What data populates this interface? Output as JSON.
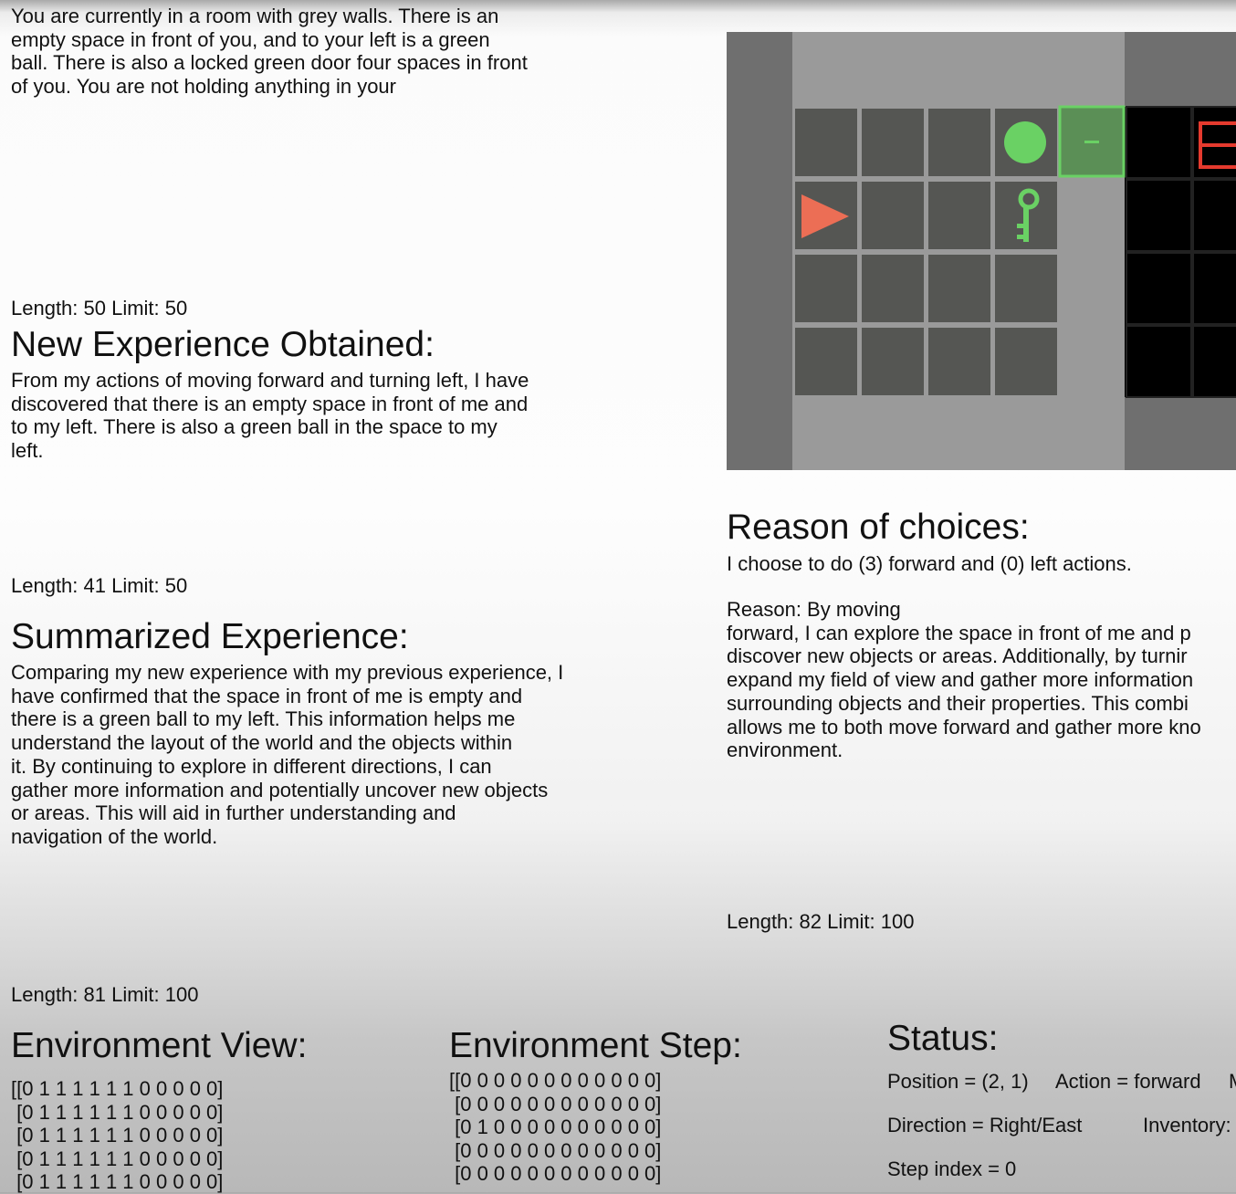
{
  "observation": {
    "text": " You are currently in a room with grey walls. There is an\nempty space in front of you, and to your left is a green\nball. There is also a locked green door four spaces in front\nof you. You are not holding anything in your",
    "meta": "Length: 50 Limit: 50"
  },
  "new_experience": {
    "title": "New Experience Obtained:",
    "text": " From my actions of moving forward and turning left, I have\ndiscovered that there is an empty space in front of me and\nto my left. There is also a green ball in the space to my\nleft.",
    "meta": "Length: 41 Limit: 50"
  },
  "summarized_experience": {
    "title": "Summarized Experience:",
    "text": " Comparing my new experience with my previous experience, I\nhave confirmed that the space in front of me is empty and\nthere is a green ball to my left. This information helps me\nunderstand the layout of the world and the objects within\nit. By continuing to explore in different directions, I can\ngather more information and potentially uncover new objects\nor areas. This will aid in further understanding and\nnavigation of the world.",
    "meta": "Length: 81 Limit: 100"
  },
  "reason": {
    "title": "Reason of choices:",
    "choice": " I choose to do (3) forward and (0) left actions.",
    "text": "Reason: By moving\nforward, I can explore the space in front of me and p\ndiscover new objects or areas. Additionally, by turnir\nexpand my field of view and gather more information\nsurrounding objects and their properties. This combi\nallows me to both move forward and gather more kno\nenvironment.",
    "meta": "Length: 82 Limit: 100"
  },
  "environment_view": {
    "title": "Environment View:",
    "rows": "[[0 1 1 1 1 1 1 0 0 0 0 0]\n [0 1 1 1 1 1 1 0 0 0 0 0]\n [0 1 1 1 1 1 1 0 0 0 0 0]\n [0 1 1 1 1 1 1 0 0 0 0 0]\n [0 1 1 1 1 1 1 0 0 0 0 0]"
  },
  "environment_step": {
    "title": "Environment Step:",
    "rows": "[[0 0 0 0 0 0 0 0 0 0 0 0]\n [0 0 0 0 0 0 0 0 0 0 0 0]\n [0 1 0 0 0 0 0 0 0 0 0 0]\n [0 0 0 0 0 0 0 0 0 0 0 0]\n [0 0 0 0 0 0 0 0 0 0 0 0]"
  },
  "status": {
    "title": "Status:",
    "position": "Position = (2, 1)",
    "action": "Action = forward",
    "cut_label": "M",
    "direction": "Direction = Right/East",
    "inventory": "Inventory:",
    "step_index": "Step index = 0"
  },
  "grid_colors": {
    "outer_wall": "#6f6f6f",
    "floor": "#9a9a9a",
    "cell": "#555653",
    "green": "#6ad164",
    "agent": "#ec6e55",
    "red": "#e53a2e"
  }
}
